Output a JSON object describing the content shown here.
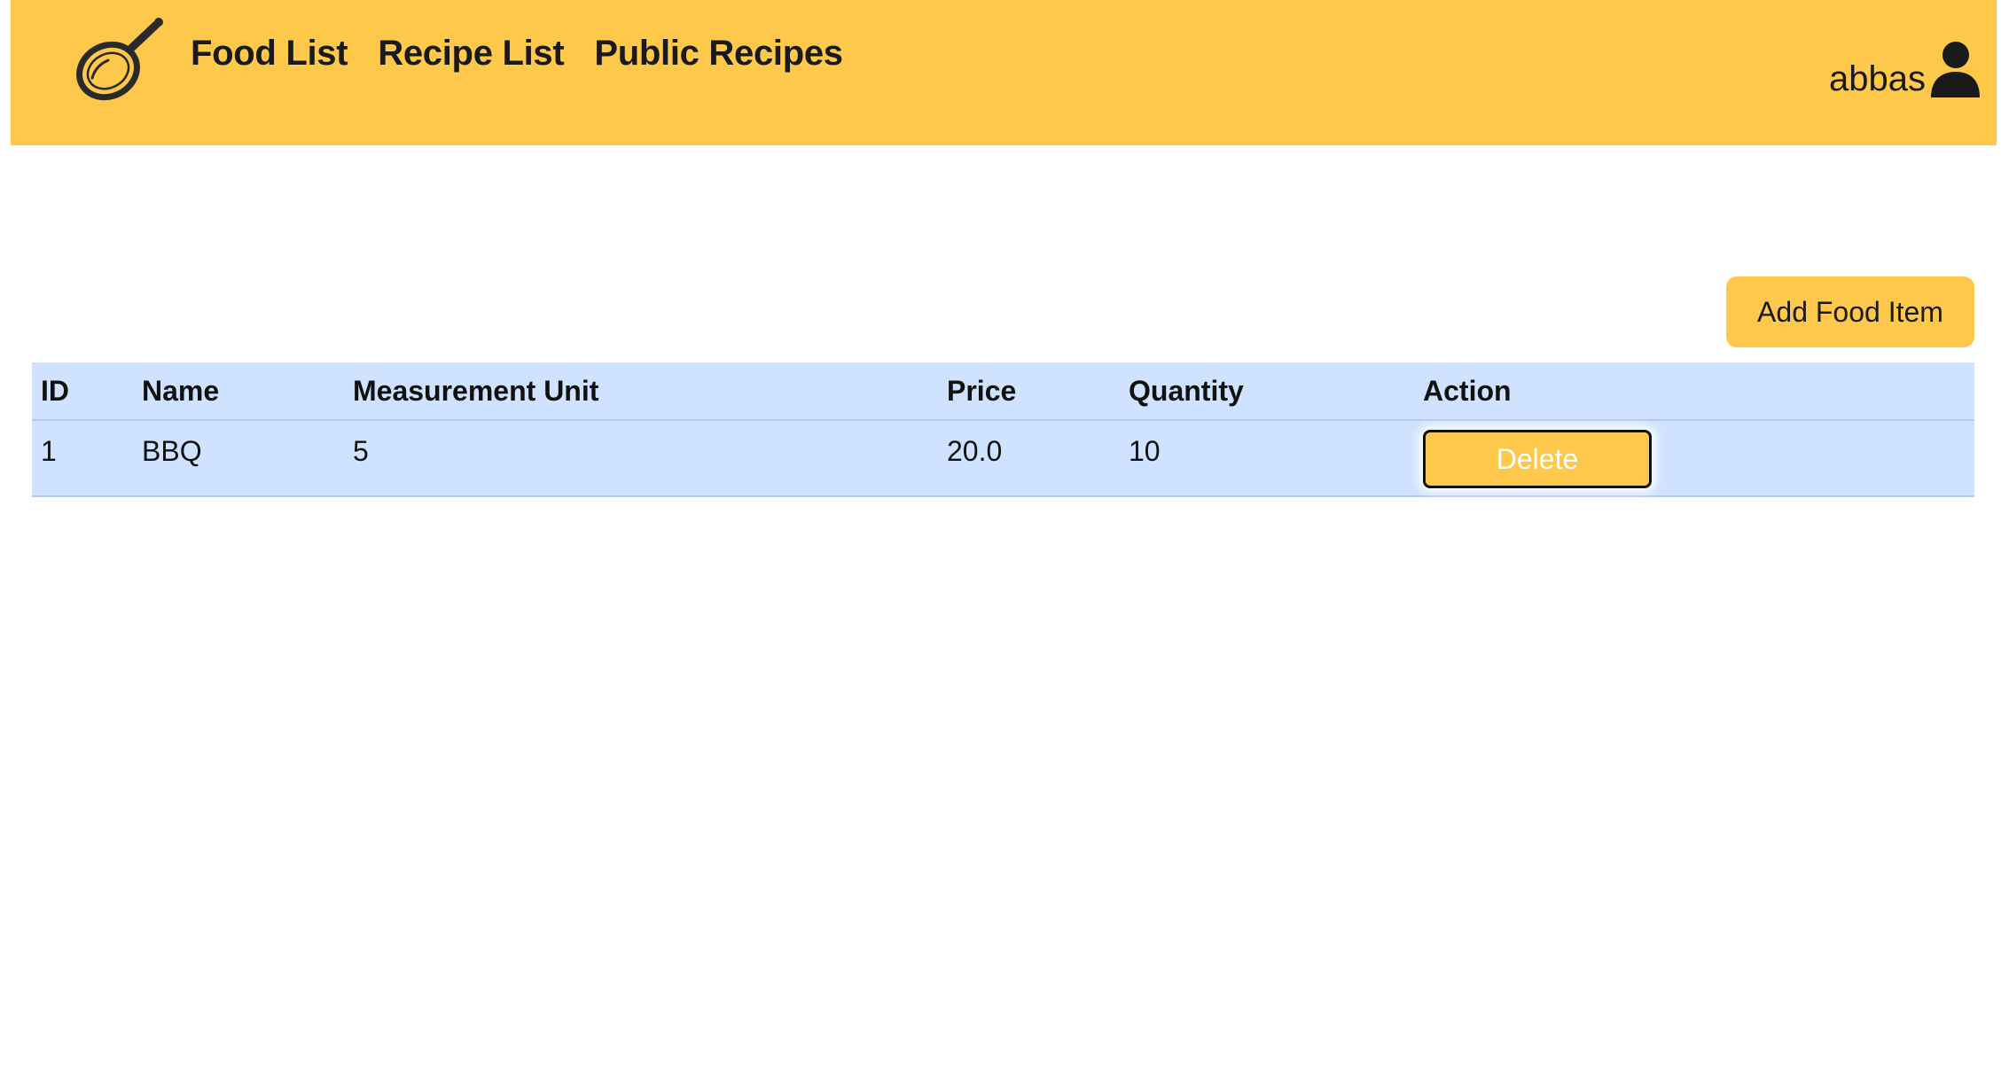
{
  "nav": {
    "logo_icon": "frying-pan-icon",
    "links": [
      {
        "label": "Food List"
      },
      {
        "label": "Recipe List"
      },
      {
        "label": "Public Recipes"
      }
    ],
    "username": "abbas",
    "user_icon": "user-icon"
  },
  "actions": {
    "add_label": "Add Food Item"
  },
  "table": {
    "headers": [
      "ID",
      "Name",
      "Measurement Unit",
      "Price",
      "Quantity",
      "Action"
    ],
    "rows": [
      {
        "id": "1",
        "name": "BBQ",
        "unit": "5",
        "price": "20.0",
        "quantity": "10",
        "action_label": "Delete"
      }
    ]
  },
  "colors": {
    "navbar": "#fec84b",
    "button": "#fec84b",
    "table_bg": "#cfe2ff"
  }
}
